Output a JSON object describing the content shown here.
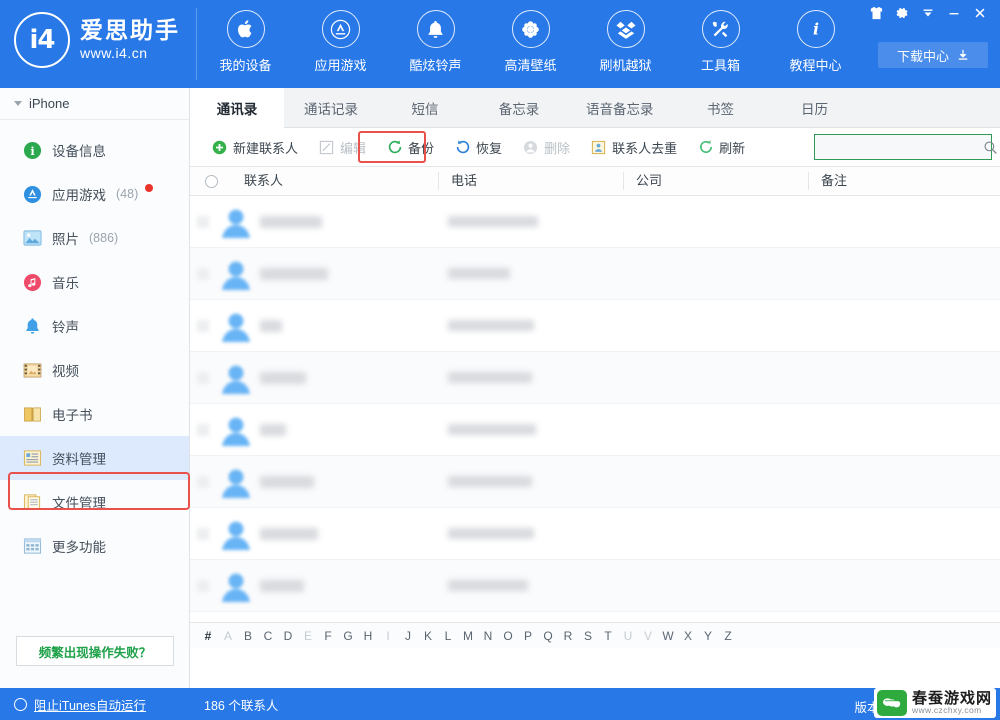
{
  "brand": {
    "mark": "i4",
    "name_cn": "爱思助手",
    "url": "www.i4.cn"
  },
  "topnav": {
    "items": [
      {
        "label": "我的设备",
        "icon": "apple-icon"
      },
      {
        "label": "应用游戏",
        "icon": "appstore-icon"
      },
      {
        "label": "酷炫铃声",
        "icon": "bell-icon"
      },
      {
        "label": "高清壁纸",
        "icon": "flower-icon"
      },
      {
        "label": "刷机越狱",
        "icon": "box-icon"
      },
      {
        "label": "工具箱",
        "icon": "tools-icon"
      },
      {
        "label": "教程中心",
        "icon": "info-icon"
      }
    ],
    "download_center": "下载中心",
    "window_buttons": [
      {
        "name": "skin-icon",
        "title": "换肤"
      },
      {
        "name": "gear-icon",
        "title": "设置"
      },
      {
        "name": "chevron-down-icon",
        "title": "更多"
      },
      {
        "name": "minimize-icon",
        "title": "最小化"
      },
      {
        "name": "close-icon",
        "title": "关闭"
      }
    ]
  },
  "sidebar": {
    "device": "iPhone",
    "items": [
      {
        "label": "设备信息",
        "icon": "info-circle-icon",
        "count": "",
        "dot": false,
        "selected": false
      },
      {
        "label": "应用游戏",
        "icon": "appstore-circle-icon",
        "count": "(48)",
        "dot": true,
        "selected": false
      },
      {
        "label": "照片",
        "icon": "photo-icon",
        "count": "(886)",
        "dot": false,
        "selected": false
      },
      {
        "label": "音乐",
        "icon": "music-icon",
        "count": "",
        "dot": false,
        "selected": false
      },
      {
        "label": "铃声",
        "icon": "ringtone-icon",
        "count": "",
        "dot": false,
        "selected": false
      },
      {
        "label": "视频",
        "icon": "video-icon",
        "count": "",
        "dot": false,
        "selected": false
      },
      {
        "label": "电子书",
        "icon": "book-icon",
        "count": "",
        "dot": false,
        "selected": false
      },
      {
        "label": "资料管理",
        "icon": "data-icon",
        "count": "",
        "dot": false,
        "selected": true
      },
      {
        "label": "文件管理",
        "icon": "file-icon",
        "count": "",
        "dot": false,
        "selected": false
      },
      {
        "label": "更多功能",
        "icon": "grid-icon",
        "count": "",
        "dot": false,
        "selected": false
      }
    ],
    "help_button": "频繁出现操作失败？"
  },
  "main": {
    "tabs": [
      {
        "label": "通讯录",
        "active": true
      },
      {
        "label": "通话记录",
        "active": false
      },
      {
        "label": "短信",
        "active": false
      },
      {
        "label": "备忘录",
        "active": false
      },
      {
        "label": "语音备忘录",
        "active": false
      },
      {
        "label": "书签",
        "active": false
      },
      {
        "label": "日历",
        "active": false
      }
    ],
    "toolbar": [
      {
        "label": "新建联系人",
        "icon": "plus-circle-icon",
        "disabled": false,
        "highlighted": false
      },
      {
        "label": "编辑",
        "icon": "edit-icon",
        "disabled": true,
        "highlighted": false
      },
      {
        "label": "备份",
        "icon": "backup-icon",
        "disabled": false,
        "highlighted": true
      },
      {
        "label": "恢复",
        "icon": "restore-icon",
        "disabled": false,
        "highlighted": false
      },
      {
        "label": "删除",
        "icon": "delete-icon",
        "disabled": true,
        "highlighted": false
      },
      {
        "label": "联系人去重",
        "icon": "dedupe-icon",
        "disabled": false,
        "highlighted": false
      },
      {
        "label": "刷新",
        "icon": "refresh-icon",
        "disabled": false,
        "highlighted": false
      }
    ],
    "search": {
      "value": "",
      "placeholder": "",
      "icon": "search-icon"
    },
    "table": {
      "columns": [
        "联系人",
        "电话",
        "公司",
        "备注"
      ],
      "select_all": "select-all-checkbox",
      "rows_blurred": true,
      "row_count_visible": 9
    },
    "alpha_index": {
      "letters": [
        "#",
        "A",
        "B",
        "C",
        "D",
        "E",
        "F",
        "G",
        "H",
        "I",
        "J",
        "K",
        "L",
        "M",
        "N",
        "O",
        "P",
        "Q",
        "R",
        "S",
        "T",
        "U",
        "V",
        "W",
        "X",
        "Y",
        "Z"
      ],
      "dim": [
        "A",
        "E",
        "I",
        "U",
        "V"
      ]
    }
  },
  "statusbar": {
    "itunes_toggle": "阻止iTunes自动运行",
    "contact_count": "186 个联系人",
    "version_label": "版本号"
  },
  "watermark": {
    "name_cn": "春蚕游戏网",
    "url": "www.czchxy.com"
  },
  "colors": {
    "brand_blue": "#2878e8",
    "highlight_red": "#e8524a",
    "search_green": "#2e9b57",
    "selected_blue": "#ddeafd"
  }
}
